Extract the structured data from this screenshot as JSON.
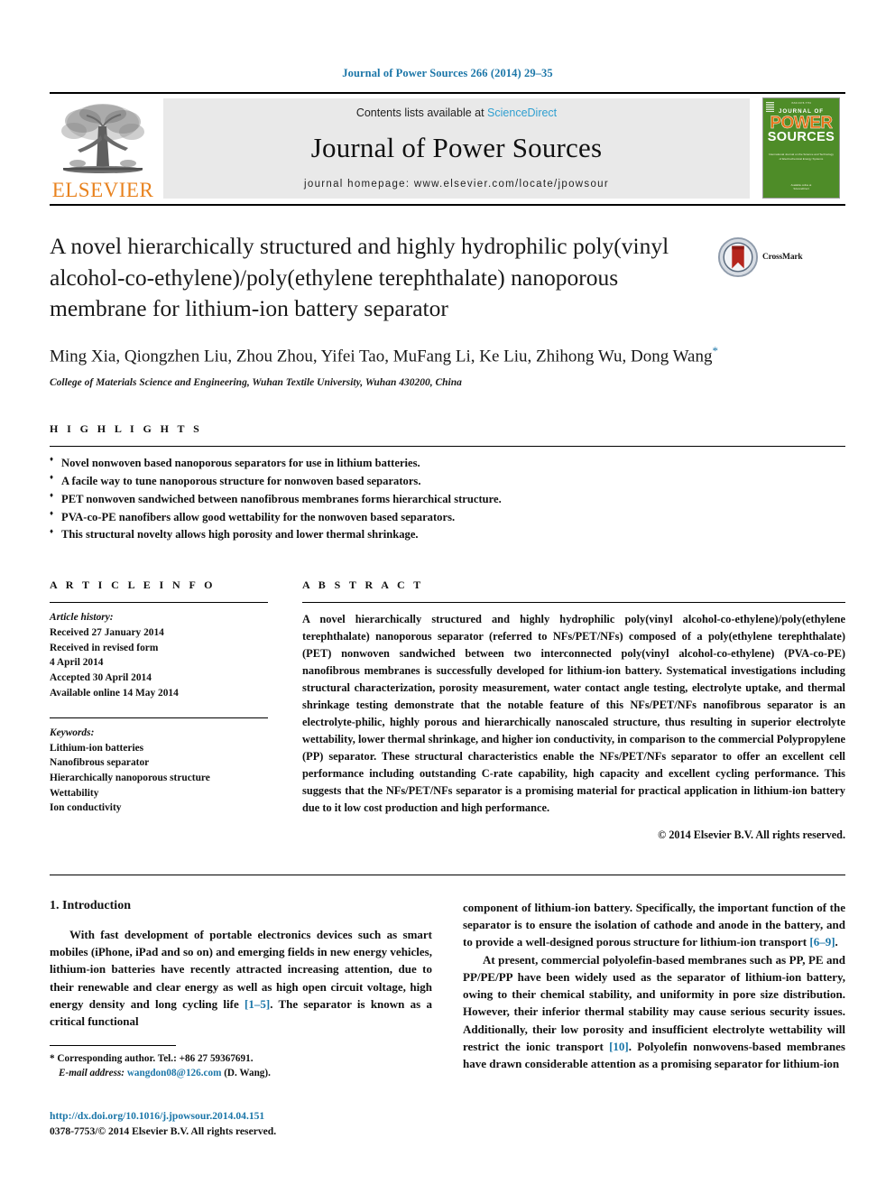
{
  "running_head": "Journal of Power Sources 266 (2014) 29–35",
  "masthead": {
    "publisher_name": "ELSEVIER",
    "contents_prefix": "Contents lists available at ",
    "contents_link": "ScienceDirect",
    "journal_name": "Journal of Power Sources",
    "homepage_line": "journal homepage: www.elsevier.com/locate/jpowsour",
    "cover": {
      "top_note": "ISSN 0378-7753",
      "line1": "JOURNAL OF",
      "line2": "POWER",
      "line3": "SOURCES",
      "blurb": "International Journal on the Science and Technology of Electrochemical Energy Systems",
      "foot1": "Available online at",
      "foot2": "ScienceDirect"
    }
  },
  "article": {
    "title": "A novel hierarchically structured and highly hydrophilic poly(vinyl alcohol-co-ethylene)/poly(ethylene terephthalate) nanoporous membrane for lithium-ion battery separator",
    "crossmark_label": "CrossMark",
    "authors": "Ming Xia, Qiongzhen Liu, Zhou Zhou, Yifei Tao, MuFang Li, Ke Liu, Zhihong Wu, Dong Wang",
    "author_marker": "*",
    "affiliation": "College of Materials Science and Engineering, Wuhan Textile University, Wuhan 430200, China"
  },
  "highlights": {
    "heading": "H I G H L I G H T S",
    "items": [
      "Novel nonwoven based nanoporous separators for use in lithium batteries.",
      "A facile way to tune nanoporous structure for nonwoven based separators.",
      "PET nonwoven sandwiched between nanofibrous membranes forms hierarchical structure.",
      "PVA-co-PE nanofibers allow good wettability for the nonwoven based separators.",
      "This structural novelty allows high porosity and lower thermal shrinkage."
    ]
  },
  "article_info": {
    "heading": "A R T I C L E   I N F O",
    "history_title": "Article history:",
    "history_lines": [
      "Received 27 January 2014",
      "Received in revised form",
      "4 April 2014",
      "Accepted 30 April 2014",
      "Available online 14 May 2014"
    ],
    "keywords_title": "Keywords:",
    "keywords": [
      "Lithium-ion batteries",
      "Nanofibrous separator",
      "Hierarchically nanoporous structure",
      "Wettability",
      "Ion conductivity"
    ]
  },
  "abstract": {
    "heading": "A B S T R A C T",
    "text": "A novel hierarchically structured and highly hydrophilic poly(vinyl alcohol-co-ethylene)/poly(ethylene terephthalate) nanoporous separator (referred to NFs/PET/NFs) composed of a poly(ethylene terephthalate) (PET) nonwoven sandwiched between two interconnected poly(vinyl alcohol-co-ethylene) (PVA-co-PE) nanofibrous membranes is successfully developed for lithium-ion battery. Systematical investigations including structural characterization, porosity measurement, water contact angle testing, electrolyte uptake, and thermal shrinkage testing demonstrate that the notable feature of this NFs/PET/NFs nanofibrous separator is an electrolyte-philic, highly porous and hierarchically nanoscaled structure, thus resulting in superior electrolyte wettability, lower thermal shrinkage, and higher ion conductivity, in comparison to the commercial Polypropylene (PP) separator. These structural characteristics enable the NFs/PET/NFs separator to offer an excellent cell performance including outstanding C-rate capability, high capacity and excellent cycling performance. This suggests that the NFs/PET/NFs separator is a promising material for practical application in lithium-ion battery due to it low cost production and high performance.",
    "copyright": "© 2014 Elsevier B.V. All rights reserved."
  },
  "body": {
    "section_title": "1.  Introduction",
    "left_paragraph_1": "With fast development of portable electronics devices such as smart mobiles (iPhone, iPad and so on) and emerging fields in new energy vehicles, lithium-ion batteries have recently attracted increasing attention, due to their renewable and clear energy as well as high open circuit voltage, high energy density and long cycling life ",
    "left_ref_1": "[1–5]",
    "left_paragraph_1_end": ". The separator is known as a critical functional",
    "right_paragraph_1": "component of lithium-ion battery. Specifically, the important function of the separator is to ensure the isolation of cathode and anode in the battery, and to provide a well-designed porous structure for lithium-ion transport ",
    "right_ref_1": "[6–9]",
    "right_paragraph_1_end": ".",
    "right_paragraph_2": "At present, commercial polyolefin-based membranes such as PP, PE and PP/PE/PP have been widely used as the separator of lithium-ion battery, owing to their chemical stability, and uniformity in pore size distribution. However, their inferior thermal stability may cause serious security issues. Additionally, their low porosity and insufficient electrolyte wettability will restrict the ionic transport ",
    "right_ref_2": "[10]",
    "right_paragraph_2_end": ". Polyolefin nonwovens-based membranes have drawn considerable attention as a promising separator for lithium-ion"
  },
  "footer": {
    "corresponding_marker": "*",
    "corresponding_text": " Corresponding author. Tel.: +86 27 59367691.",
    "email_label": "E-mail address:",
    "email": "wangdon08@126.com",
    "email_suffix": " (D. Wang).",
    "doi": "http://dx.doi.org/10.1016/j.jpowsour.2014.04.151",
    "issn": "0378-7753/© 2014 Elsevier B.V. All rights reserved."
  },
  "colors": {
    "link": "#1b76a8",
    "sciencedirect": "#2f9fd0",
    "elsevier_orange": "#e8821e",
    "cover_green": "#4e8c28",
    "band_gray": "#e9e9e9"
  }
}
